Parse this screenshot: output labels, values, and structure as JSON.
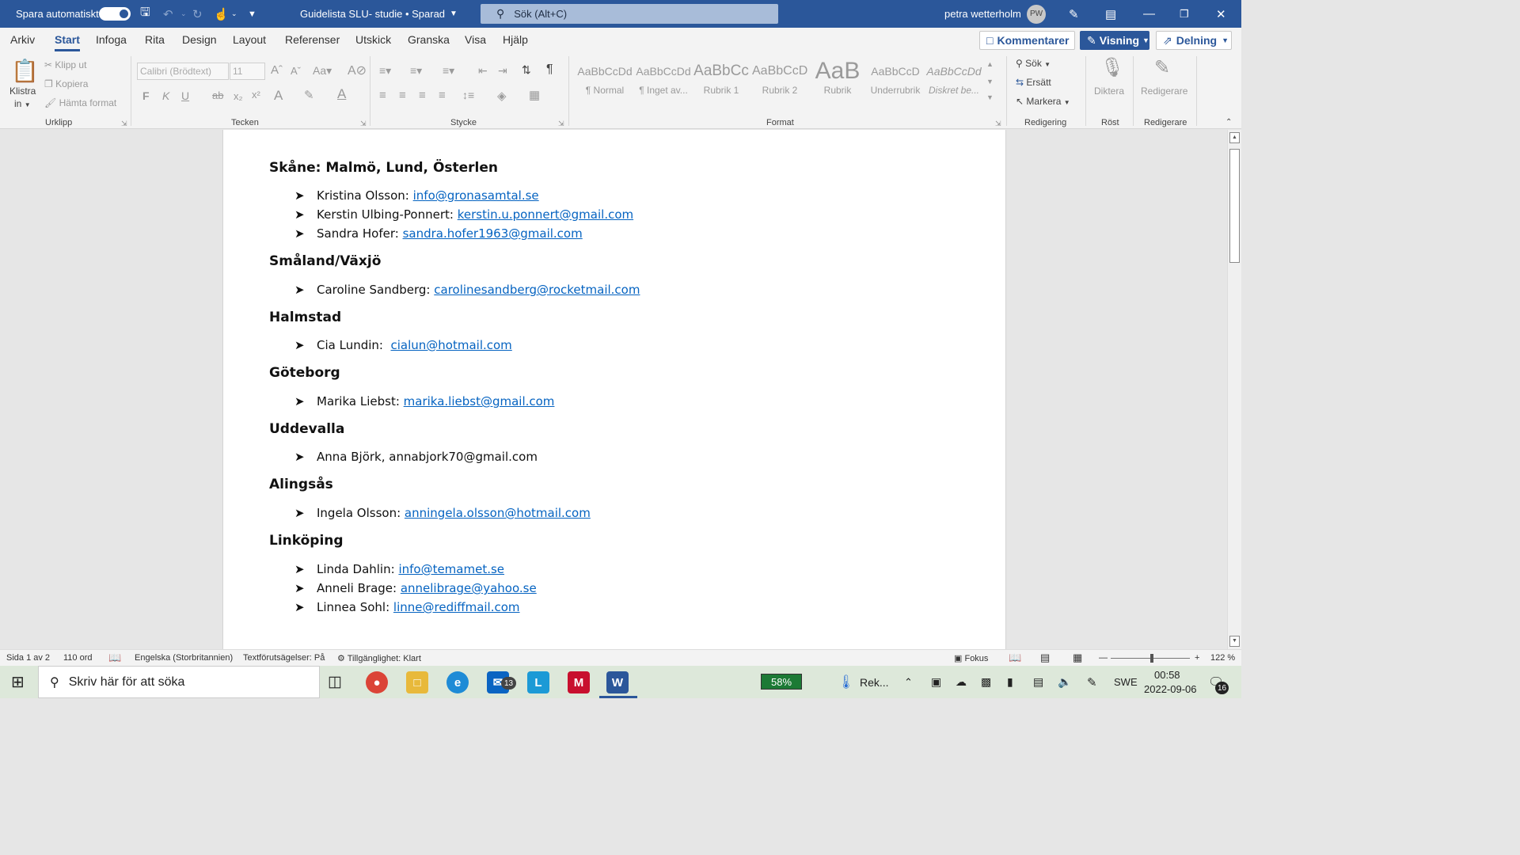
{
  "titlebar": {
    "autosave_label": "Spara automatiskt",
    "doc_title": "Guidelista SLU- studie • Sparad",
    "search_placeholder": "Sök (Alt+C)",
    "user_name": "petra wetterholm",
    "user_initials": "PW"
  },
  "tabs": [
    "Arkiv",
    "Start",
    "Infoga",
    "Rita",
    "Design",
    "Layout",
    "Referenser",
    "Utskick",
    "Granska",
    "Visa",
    "Hjälp"
  ],
  "active_tab": "Start",
  "top_buttons": {
    "comments": "Kommentarer",
    "view": "Visning",
    "share": "Delning"
  },
  "ribbon": {
    "clipboard": {
      "paste": "Klistra",
      "paste2": "in",
      "cut": "Klipp ut",
      "copy": "Kopiera",
      "format_painter": "Hämta format",
      "label": "Urklipp"
    },
    "font": {
      "font_name": "Calibri (Brödtext)",
      "font_size": "11",
      "label": "Tecken"
    },
    "paragraph": {
      "label": "Stycke"
    },
    "styles": {
      "label": "Format",
      "items": [
        {
          "preview": "AaBbCcDd",
          "name": "¶ Normal"
        },
        {
          "preview": "AaBbCcDd",
          "name": "¶ Inget av..."
        },
        {
          "preview": "AaBbCc",
          "name": "Rubrik 1"
        },
        {
          "preview": "AaBbCcD",
          "name": "Rubrik 2"
        },
        {
          "preview": "AaB",
          "name": "Rubrik"
        },
        {
          "preview": "AaBbCcD",
          "name": "Underrubrik"
        },
        {
          "preview": "AaBbCcDd",
          "name": "Diskret be..."
        }
      ]
    },
    "editing": {
      "find": "Sök",
      "replace": "Ersätt",
      "select": "Markera",
      "label": "Redigering"
    },
    "voice": {
      "dictate": "Diktera",
      "label": "Röst"
    },
    "editor": {
      "editor": "Redigerare",
      "label": "Redigerare"
    }
  },
  "document": {
    "sections": [
      {
        "heading": "Skåne: Malmö, Lund, Österlen",
        "entries": [
          {
            "name": "Kristina Olsson: ",
            "email": "info@gronasamtal.se"
          },
          {
            "name": "Kerstin Ulbing-Ponnert: ",
            "email": "kerstin.u.ponnert@gmail.com"
          },
          {
            "name": "Sandra Hofer: ",
            "email": "sandra.hofer1963@gmail.com"
          }
        ]
      },
      {
        "heading": "Småland/Växjö",
        "entries": [
          {
            "name": "Caroline Sandberg: ",
            "email": "carolinesandberg@rocketmail.com"
          }
        ]
      },
      {
        "heading": "Halmstad",
        "entries": [
          {
            "name": "Cia Lundin:  ",
            "email": "cialun@hotmail.com"
          }
        ]
      },
      {
        "heading": "Göteborg",
        "entries": [
          {
            "name": "Marika Liebst: ",
            "email": "marika.liebst@gmail.com"
          }
        ]
      },
      {
        "heading": "Uddevalla",
        "entries": [
          {
            "name": "Anna Björk, annabjork70@gmail.com",
            "email": ""
          }
        ]
      },
      {
        "heading": "Alingsås",
        "entries": [
          {
            "name": "Ingela Olsson: ",
            "email": "anningela.olsson@hotmail.com"
          }
        ]
      },
      {
        "heading": "Linköping",
        "entries": [
          {
            "name": "Linda Dahlin: ",
            "email": "info@temamet.se"
          },
          {
            "name": "Anneli Brage: ",
            "email": "annelibrage@yahoo.se"
          },
          {
            "name": "Linnea Sohl: ",
            "email": "linne@rediffmail.com"
          }
        ]
      }
    ]
  },
  "statusbar": {
    "page": "Sida 1 av 2",
    "words": "110 ord",
    "language": "Engelska (Storbritannien)",
    "predictions": "Textförutsägelser: På",
    "accessibility": "Tillgänglighet: Klart",
    "focus": "Fokus",
    "zoom": "122 %"
  },
  "taskbar": {
    "search_placeholder": "Skriv här för att söka",
    "mail_badge": "13",
    "battery": "58%",
    "weather": "Rek...",
    "language": "SWE",
    "time": "00:58",
    "date": "2022-09-06",
    "notifications": "16"
  },
  "colors": {
    "brand": "#2b579a",
    "link": "#0563c1"
  }
}
